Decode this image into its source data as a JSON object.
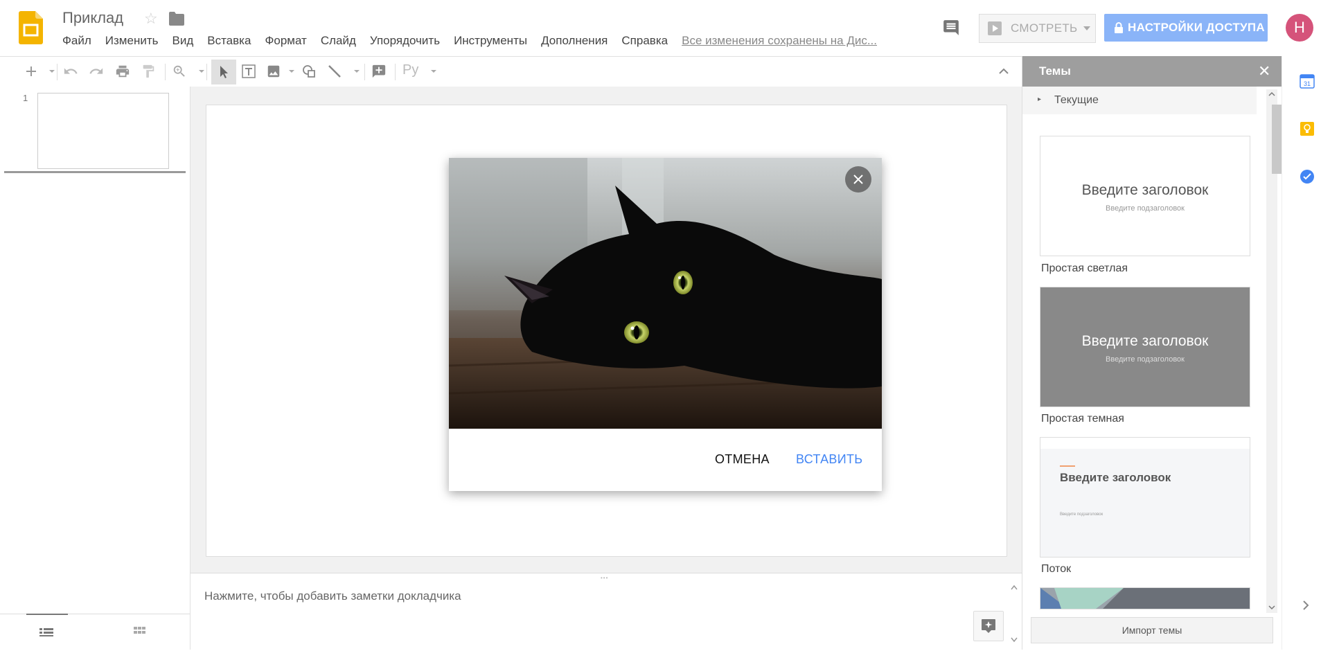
{
  "header": {
    "doc_title": "Приклад",
    "menus": [
      "Файл",
      "Изменить",
      "Вид",
      "Вставка",
      "Формат",
      "Слайд",
      "Упорядочить",
      "Инструменты",
      "Дополнения",
      "Справка"
    ],
    "save_status": "Все изменения сохранены на Дис...",
    "present_label": "СМОТРЕТЬ",
    "share_label": "НАСТРОЙКИ ДОСТУПА",
    "avatar_initial": "Н"
  },
  "toolbar": {
    "input_tools_label": "Ру"
  },
  "filmstrip": {
    "slide_number": "1"
  },
  "notes": {
    "placeholder": "Нажмите, чтобы добавить заметки докладчика"
  },
  "image_dialog": {
    "cancel_label": "ОТМЕНА",
    "insert_label": "ВСТАВИТЬ"
  },
  "themes": {
    "title": "Темы",
    "current_label": "Текущие",
    "items": [
      {
        "name": "Простая светлая",
        "card_title": "Введите заголовок",
        "card_subtitle": "Введите подзаголовок"
      },
      {
        "name": "Простая темная",
        "card_title": "Введите заголовок",
        "card_subtitle": "Введите подзаголовок"
      },
      {
        "name": "Поток",
        "card_title": "Введите заголовок",
        "card_subtitle": "Введите подзаголовок"
      }
    ],
    "import_label": "Импорт темы"
  },
  "colors": {
    "share_button": "#8ab4f8",
    "avatar": "#d5537a",
    "insert_link": "#4285f4",
    "themes_header": "#9e9e9e",
    "slides_logo": "#f4b400"
  },
  "side_icons": [
    "calendar-icon",
    "keep-icon",
    "tasks-icon"
  ],
  "side_icons_text": {
    "calendar_day": "31"
  }
}
